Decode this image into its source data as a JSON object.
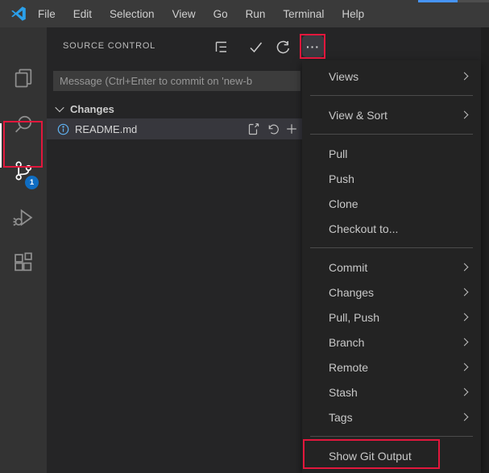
{
  "title_bar": {
    "items": [
      "File",
      "Edit",
      "Selection",
      "View",
      "Go",
      "Run",
      "Terminal",
      "Help"
    ]
  },
  "activity_bar": {
    "items": [
      {
        "name": "explorer"
      },
      {
        "name": "search"
      },
      {
        "name": "source-control",
        "active": true,
        "badge": "1"
      },
      {
        "name": "run-and-debug"
      },
      {
        "name": "extensions"
      }
    ],
    "source_control_badge": "1"
  },
  "source_control": {
    "title": "SOURCE CONTROL",
    "toolbar": {
      "view_as_tree": "tree-icon",
      "commit": "check-icon",
      "refresh": "refresh-icon",
      "more_actions_glyph": "···"
    },
    "commit_placeholder": "Message (Ctrl+Enter to commit on 'new-b",
    "changes_label": "Changes",
    "files": [
      {
        "name": "README.md",
        "status_icon": "info-icon",
        "actions": [
          "open-file",
          "discard-changes",
          "stage-changes"
        ]
      }
    ]
  },
  "context_menu": {
    "groups": [
      {
        "items": [
          {
            "label": "Views",
            "has_submenu": true
          }
        ]
      },
      {
        "items": [
          {
            "label": "View & Sort",
            "has_submenu": true
          }
        ]
      },
      {
        "items": [
          {
            "label": "Pull"
          },
          {
            "label": "Push"
          },
          {
            "label": "Clone"
          },
          {
            "label": "Checkout to..."
          }
        ]
      },
      {
        "items": [
          {
            "label": "Commit",
            "has_submenu": true
          },
          {
            "label": "Changes",
            "has_submenu": true
          },
          {
            "label": "Pull, Push",
            "has_submenu": true
          },
          {
            "label": "Branch",
            "has_submenu": true
          },
          {
            "label": "Remote",
            "has_submenu": true
          },
          {
            "label": "Stash",
            "has_submenu": true
          },
          {
            "label": "Tags",
            "has_submenu": true
          }
        ]
      },
      {
        "items": [
          {
            "label": "Show Git Output",
            "annotated": true
          }
        ]
      }
    ]
  },
  "annotations": {
    "highlight_color": "#e2173c",
    "highlighted": [
      "source-control-activity-button",
      "more-actions-button",
      "menu-item-show-git-output"
    ]
  },
  "colors": {
    "title_bar": "#3a3a3a",
    "activity_bar": "#333333",
    "sidebar": "#252526",
    "menu": "#232323",
    "input": "#3c3c3c",
    "selected_row": "#37373d",
    "badge": "#0f6dc2",
    "info_icon": "#5fb2f2",
    "annotation_red": "#e2173c",
    "top_strip_blue": "#4694f8",
    "text": "#cccccc"
  }
}
